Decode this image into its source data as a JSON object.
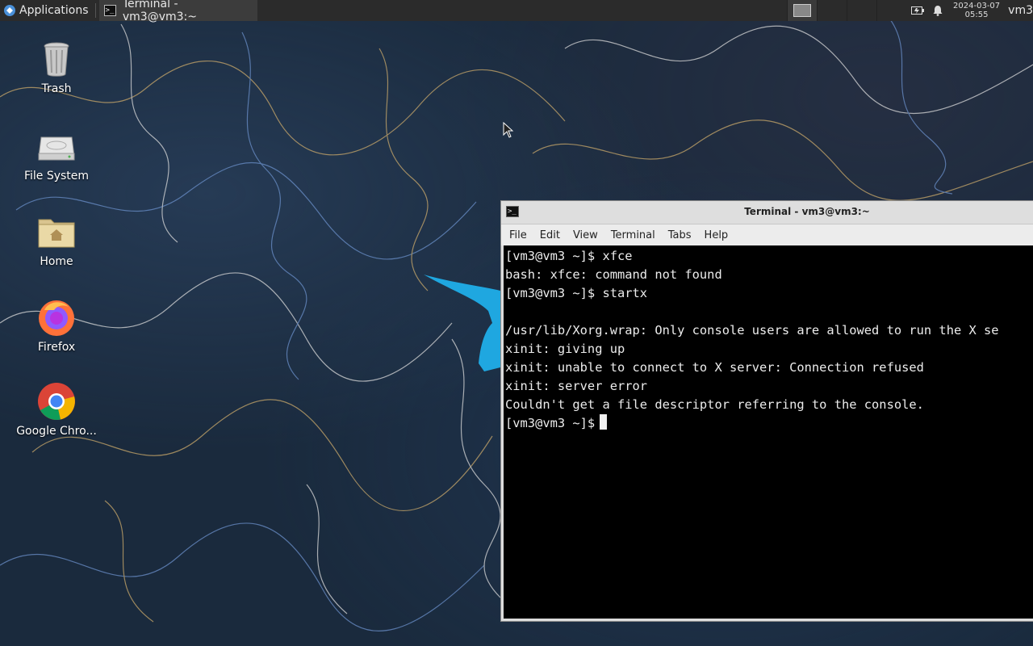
{
  "panel": {
    "applications_label": "Applications",
    "task_label": "Terminal - vm3@vm3:~",
    "clock_date": "2024-03-07",
    "clock_time": "05:55",
    "user": "vm3"
  },
  "desktop_icons": [
    {
      "label": "Trash",
      "icon": "trash-icon"
    },
    {
      "label": "File System",
      "icon": "drive-icon"
    },
    {
      "label": "Home",
      "icon": "home-folder-icon"
    },
    {
      "label": "Firefox",
      "icon": "firefox-icon"
    },
    {
      "label": "Google Chro...",
      "icon": "chrome-icon"
    }
  ],
  "terminal": {
    "title": "Terminal - vm3@vm3:~",
    "menu": [
      "File",
      "Edit",
      "View",
      "Terminal",
      "Tabs",
      "Help"
    ],
    "lines": [
      "[vm3@vm3 ~]$ xfce",
      "bash: xfce: command not found",
      "[vm3@vm3 ~]$ startx",
      "",
      "/usr/lib/Xorg.wrap: Only console users are allowed to run the X se",
      "xinit: giving up",
      "xinit: unable to connect to X server: Connection refused",
      "xinit: server error",
      "Couldn't get a file descriptor referring to the console."
    ],
    "prompt": "[vm3@vm3 ~]$"
  },
  "colors": {
    "panel_bg": "#2b2b2b",
    "terminal_bg": "#000000",
    "desktop_bg": "#1a2a3d"
  }
}
